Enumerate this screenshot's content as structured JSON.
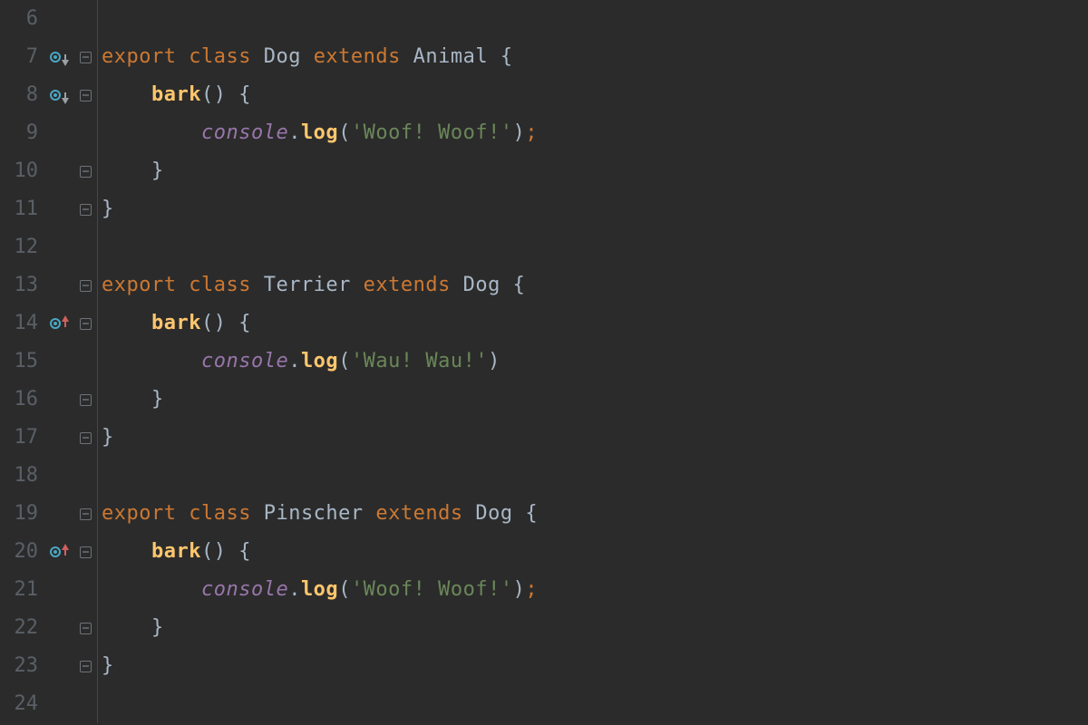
{
  "lines": [
    {
      "n": 6,
      "icon": null,
      "fold": null,
      "tokens": []
    },
    {
      "n": 7,
      "icon": "overridden-down",
      "fold": "open",
      "tokens": [
        {
          "t": "kw",
          "v": "export "
        },
        {
          "t": "kw",
          "v": "class "
        },
        {
          "t": "cls",
          "v": "Dog "
        },
        {
          "t": "kw",
          "v": "extends "
        },
        {
          "t": "cls",
          "v": "Animal "
        },
        {
          "t": "brace",
          "v": "{"
        }
      ]
    },
    {
      "n": 8,
      "icon": "overridden-down",
      "fold": "open",
      "tokens": [
        {
          "t": "plain",
          "v": "    "
        },
        {
          "t": "fn",
          "v": "bark"
        },
        {
          "t": "punct",
          "v": "() "
        },
        {
          "t": "brace",
          "v": "{"
        }
      ]
    },
    {
      "n": 9,
      "icon": null,
      "fold": null,
      "tokens": [
        {
          "t": "plain",
          "v": "        "
        },
        {
          "t": "obj",
          "v": "console"
        },
        {
          "t": "punct",
          "v": "."
        },
        {
          "t": "fn",
          "v": "log"
        },
        {
          "t": "punct",
          "v": "("
        },
        {
          "t": "str",
          "v": "'Woof! Woof!'"
        },
        {
          "t": "punct",
          "v": ")"
        },
        {
          "t": "semi",
          "v": ";"
        }
      ]
    },
    {
      "n": 10,
      "icon": null,
      "fold": "open",
      "tokens": [
        {
          "t": "plain",
          "v": "    "
        },
        {
          "t": "brace",
          "v": "}"
        }
      ]
    },
    {
      "n": 11,
      "icon": null,
      "fold": "open",
      "tokens": [
        {
          "t": "brace",
          "v": "}"
        }
      ]
    },
    {
      "n": 12,
      "icon": null,
      "fold": null,
      "tokens": []
    },
    {
      "n": 13,
      "icon": null,
      "fold": "open",
      "tokens": [
        {
          "t": "kw",
          "v": "export "
        },
        {
          "t": "kw",
          "v": "class "
        },
        {
          "t": "cls",
          "v": "Terrier "
        },
        {
          "t": "kw",
          "v": "extends "
        },
        {
          "t": "cls",
          "v": "Dog "
        },
        {
          "t": "brace",
          "v": "{"
        }
      ]
    },
    {
      "n": 14,
      "icon": "overrides-up",
      "fold": "open",
      "tokens": [
        {
          "t": "plain",
          "v": "    "
        },
        {
          "t": "fn",
          "v": "bark"
        },
        {
          "t": "punct",
          "v": "() "
        },
        {
          "t": "brace",
          "v": "{"
        }
      ]
    },
    {
      "n": 15,
      "icon": null,
      "fold": null,
      "tokens": [
        {
          "t": "plain",
          "v": "        "
        },
        {
          "t": "obj",
          "v": "console"
        },
        {
          "t": "punct",
          "v": "."
        },
        {
          "t": "fn",
          "v": "log"
        },
        {
          "t": "punct",
          "v": "("
        },
        {
          "t": "str",
          "v": "'Wau! Wau!'"
        },
        {
          "t": "punct",
          "v": ")"
        }
      ]
    },
    {
      "n": 16,
      "icon": null,
      "fold": "open",
      "tokens": [
        {
          "t": "plain",
          "v": "    "
        },
        {
          "t": "brace",
          "v": "}"
        }
      ]
    },
    {
      "n": 17,
      "icon": null,
      "fold": "open",
      "tokens": [
        {
          "t": "brace",
          "v": "}"
        }
      ]
    },
    {
      "n": 18,
      "icon": null,
      "fold": null,
      "tokens": []
    },
    {
      "n": 19,
      "icon": null,
      "fold": "open",
      "tokens": [
        {
          "t": "kw",
          "v": "export "
        },
        {
          "t": "kw",
          "v": "class "
        },
        {
          "t": "cls",
          "v": "Pinscher "
        },
        {
          "t": "kw",
          "v": "extends "
        },
        {
          "t": "cls",
          "v": "Dog "
        },
        {
          "t": "brace",
          "v": "{"
        }
      ]
    },
    {
      "n": 20,
      "icon": "overrides-up",
      "fold": "open",
      "tokens": [
        {
          "t": "plain",
          "v": "    "
        },
        {
          "t": "fn",
          "v": "bark"
        },
        {
          "t": "punct",
          "v": "() "
        },
        {
          "t": "brace",
          "v": "{"
        }
      ]
    },
    {
      "n": 21,
      "icon": null,
      "fold": null,
      "tokens": [
        {
          "t": "plain",
          "v": "        "
        },
        {
          "t": "obj",
          "v": "console"
        },
        {
          "t": "punct",
          "v": "."
        },
        {
          "t": "fn",
          "v": "log"
        },
        {
          "t": "punct",
          "v": "("
        },
        {
          "t": "str",
          "v": "'Woof! Woof!'"
        },
        {
          "t": "punct",
          "v": ")"
        },
        {
          "t": "semi",
          "v": ";"
        }
      ]
    },
    {
      "n": 22,
      "icon": null,
      "fold": "open",
      "tokens": [
        {
          "t": "plain",
          "v": "    "
        },
        {
          "t": "brace",
          "v": "}"
        }
      ]
    },
    {
      "n": 23,
      "icon": null,
      "fold": "open",
      "tokens": [
        {
          "t": "brace",
          "v": "}"
        }
      ]
    },
    {
      "n": 24,
      "icon": null,
      "fold": null,
      "tokens": []
    }
  ]
}
